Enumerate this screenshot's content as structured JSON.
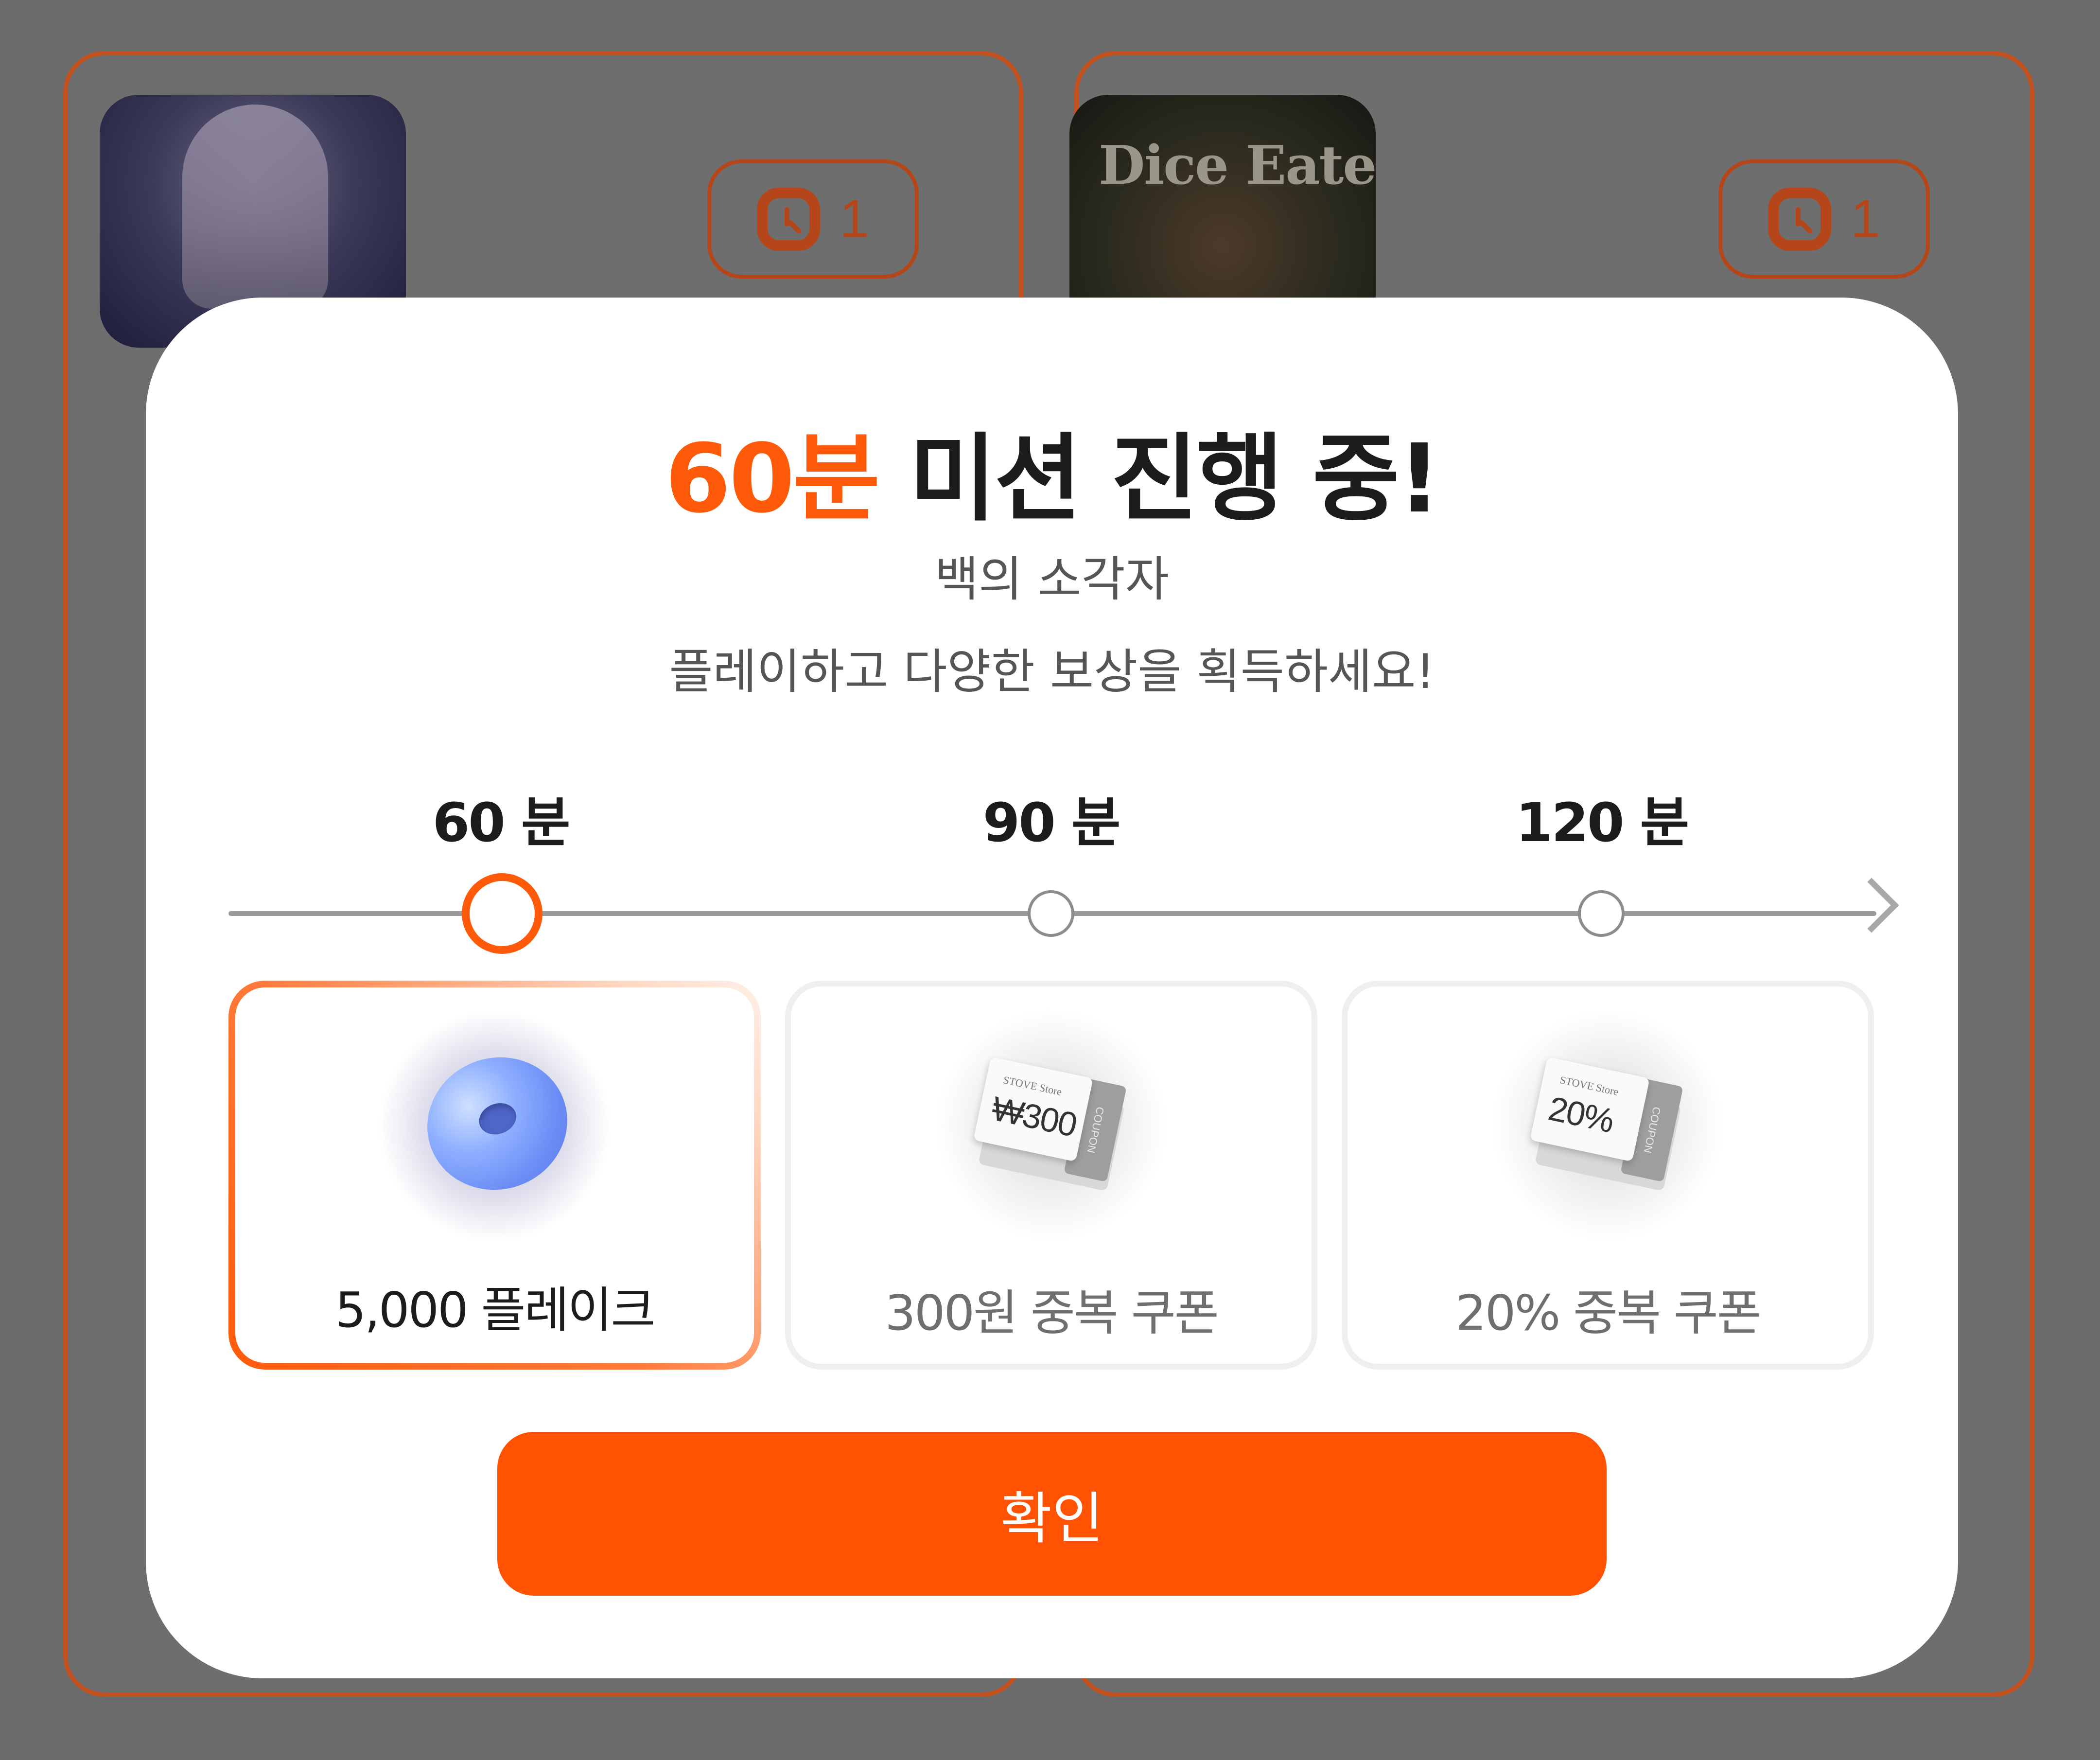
{
  "background": {
    "cards": [
      {
        "thumb_title": "",
        "timer_count": "1"
      },
      {
        "thumb_title": "Dice Eater",
        "timer_count": "1"
      }
    ]
  },
  "modal": {
    "title_accent": "60분",
    "title_rest": " 미션 진행 중!",
    "game_name": "백의 소각자",
    "description": "플레이하고 다양한 보상을 획득하세요!",
    "milestones": [
      {
        "label": "60 분",
        "active": true
      },
      {
        "label": "90 분",
        "active": false
      },
      {
        "label": "120 분",
        "active": false
      }
    ],
    "rewards": [
      {
        "label": "5,000 플레이크",
        "icon": "donut-icon",
        "selected": true
      },
      {
        "label": "300원 중복 쿠폰",
        "icon": "coupon-icon",
        "coupon_value": "₩300",
        "coupon_brand": "STOVE Store",
        "coupon_stub": "COUPON",
        "selected": false
      },
      {
        "label": "20% 중복 쿠폰",
        "icon": "coupon-icon",
        "coupon_value": "20%",
        "coupon_brand": "STOVE Store",
        "coupon_stub": "COUPON",
        "selected": false
      }
    ],
    "confirm_label": "확인"
  },
  "colors": {
    "accent": "#ff5a0a",
    "button": "#ff5203",
    "overlay": "#6b6b6b",
    "card_border_bg": "#c2521e"
  }
}
